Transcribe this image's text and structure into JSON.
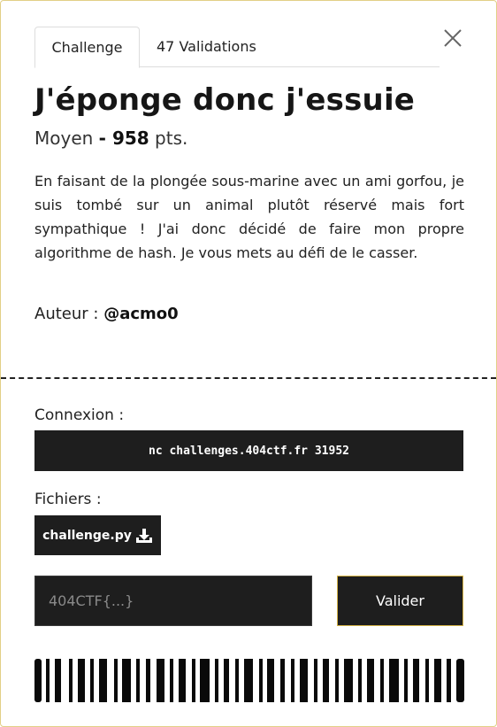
{
  "tabs": [
    {
      "label": "Challenge",
      "active": true
    },
    {
      "label": "47 Validations",
      "active": false
    }
  ],
  "challenge": {
    "title": "J'éponge donc j'essuie",
    "difficulty": "Moyen",
    "separator": "-",
    "points": "958",
    "points_unit": "pts.",
    "description": "En faisant de la plongée sous-marine avec un ami gorfou, je suis tombé sur un animal plutôt réservé mais fort sympathique ! J'ai donc décidé de faire mon propre algorithme de hash. Je vous mets au défi de le casser.",
    "author_label": "Auteur :",
    "author": "@acmo0"
  },
  "connection": {
    "label": "Connexion :",
    "command": "nc challenges.404ctf.fr 31952"
  },
  "files": {
    "label": "Fichiers :",
    "items": [
      {
        "name": "challenge.py",
        "icon": "download-icon"
      }
    ]
  },
  "flag_form": {
    "placeholder": "404CTF{...}",
    "value": "",
    "submit_label": "Valider"
  },
  "colors": {
    "accent_border": "#d4b245",
    "card_border": "#e2cf86",
    "dark": "#1e1e1e"
  },
  "icons": {
    "close": "close-icon",
    "download": "download-icon",
    "barcode": "barcode-graphic"
  }
}
